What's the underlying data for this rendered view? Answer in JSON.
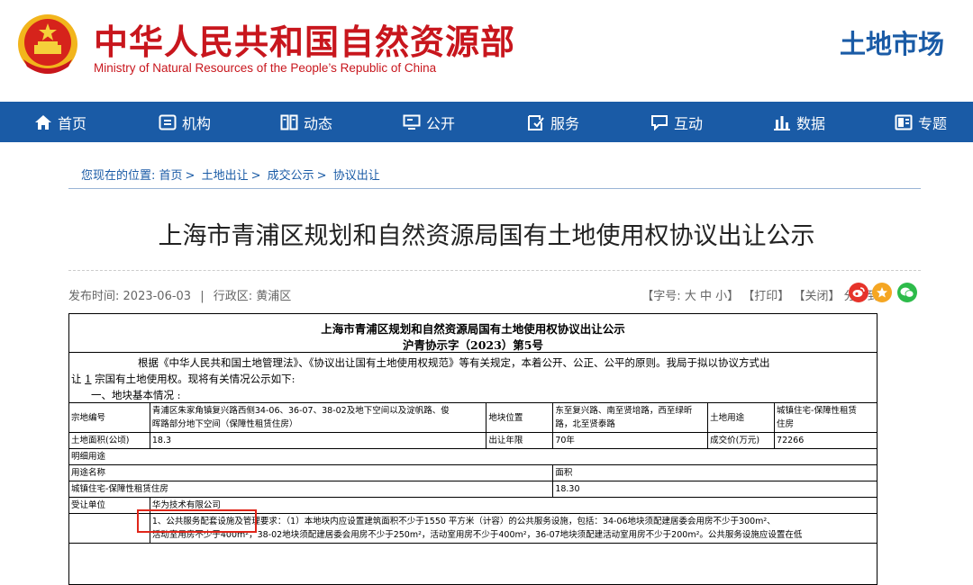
{
  "header": {
    "ministry_cn": "中华人民共和国自然资源部",
    "ministry_en": "Ministry of Natural Resources of the People’s Republic of China",
    "section": "土地市场"
  },
  "nav": [
    {
      "label": "首页",
      "icon": "home-icon"
    },
    {
      "label": "机构",
      "icon": "org-icon"
    },
    {
      "label": "动态",
      "icon": "news-icon"
    },
    {
      "label": "公开",
      "icon": "monitor-icon"
    },
    {
      "label": "服务",
      "icon": "service-icon"
    },
    {
      "label": "互动",
      "icon": "chat-icon"
    },
    {
      "label": "数据",
      "icon": "chart-icon"
    },
    {
      "label": "专题",
      "icon": "topic-icon"
    }
  ],
  "breadcrumb": {
    "prefix": "您现在的位置:",
    "items": [
      "首页",
      "土地出让",
      "成交公示",
      "协议出让"
    ]
  },
  "article": {
    "title": "上海市青浦区规划和自然资源局国有土地使用权协议出让公示",
    "publish_label": "发布时间:",
    "publish_date": "2023-06-03",
    "region_label": "行政区:",
    "region": "黄浦区",
    "font_label": "【字号:",
    "font_sizes": [
      "大",
      "中",
      "小"
    ],
    "print": "【打印】",
    "close": "【关闭】",
    "share_label": "分享到:",
    "share_icons": [
      "weibo-icon",
      "qzone-icon",
      "wechat-icon"
    ]
  },
  "doc": {
    "heading": "上海市青浦区规划和自然资源局国有土地使用权协议出让公示",
    "number": "沪青协示字（2023）第5号",
    "para1": "根据《中华人民共和国土地管理法》、《协议出让国有土地使用权规范》等有关规定，本着公开、公正、公平的原则。我局于拟以协议方式出",
    "para2_pre": "让",
    "para2_num": "1",
    "para2_post": "宗国有土地使用权。现将有关情况公示如下:",
    "section1": "一、地块基本情况 :",
    "rows": {
      "parcel_label": "宗地编号",
      "parcel_value_1": "青浦区朱家角镇复兴路西侧34-06、36-07、38-02及地下空间以及淀帆路、俊",
      "parcel_value_2": "晖路部分地下空间（保障性租赁住房）",
      "location_label": "地块位置",
      "location_value_1": "东至复兴路、南至贤培路，西至绿昕",
      "location_value_2": "路，北至贤泰路",
      "use_label": "土地用途",
      "use_value_1": "城镇住宅-保障性租赁",
      "use_value_2": "住房",
      "area_label": "土地面积(公顷)",
      "area_value": "18.3",
      "term_label": "出让年限",
      "term_value": "70年",
      "price_label": "成交价(万元)",
      "price_value": "72266",
      "detail_label": "明细用途",
      "usename_label": "用途名称",
      "mj_label": "面积",
      "detail_name": "城镇住宅-保障性租赁住房",
      "detail_area": "18.30",
      "assignee_label": "受让单位",
      "assignee_value": "华为技术有限公司",
      "cond_1": "1、公共服务配套设施及管理要求：（1）本地块内应设置建筑面积不少于1550 平方米（计容）的公共服务设施，包括：34-06地块须配建居委会用房不少于300m²、",
      "cond_2": "活动室用房不少于400m²，38-02地块须配建居委会用房不少于250m²，活动室用房不少于400m²，36-07地块须配建活动室用房不少于200m²。公共服务设施应设置在低"
    }
  },
  "colors": {
    "brand_red": "#c8161d",
    "nav_blue": "#1a5ba6",
    "highlight": "#e0261a"
  }
}
